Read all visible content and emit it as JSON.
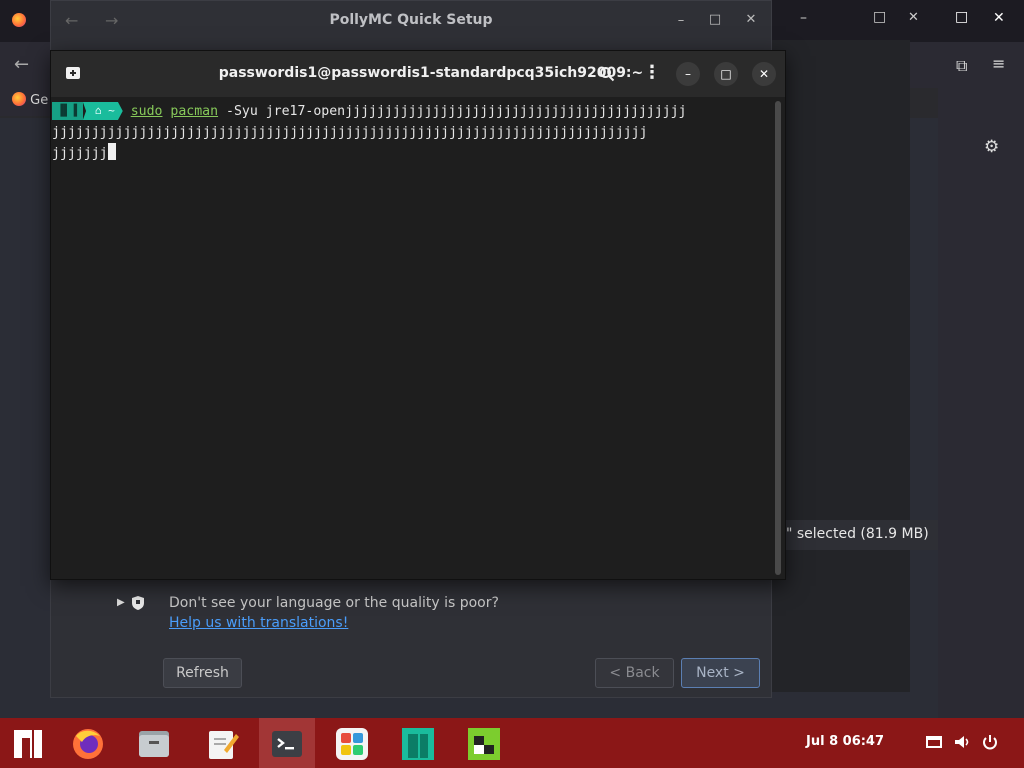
{
  "browser": {
    "bookmark_label": "Ge",
    "right_selected_text": "\" selected  (81.9 MB)"
  },
  "setup_dialog": {
    "title": "PollyMC Quick Setup",
    "language_note": "Don't see your language or the quality is poor?",
    "translations_link": "Help us with translations!",
    "refresh_label": "Refresh",
    "back_label": "< Back",
    "next_label": "Next >"
  },
  "terminal": {
    "title": "passwordis1@passwordis1-standardpcq35ich92009:~",
    "prompt_home": "~",
    "command_sudo": "sudo",
    "command_pacman": "pacman",
    "command_rest_line1": " -Syu jre17-openjjjjjjjjjjjjjjjjjjjjjjjjjjjjjjjjjjjjjjjjjjj",
    "command_line2": "jjjjjjjjjjjjjjjjjjjjjjjjjjjjjjjjjjjjjjjjjjjjjjjjjjjjjjjjjjjjjjjjjjjjjjjjjjj",
    "command_line3": "jjjjjjj"
  },
  "taskbar": {
    "clock": "Jul 8  06:47"
  },
  "icons": {
    "window_minimize": "–",
    "window_maximize": "□",
    "window_close": "✕"
  },
  "colors": {
    "taskbar": "#8b1717",
    "prompt_accent": "#1abc9c",
    "link": "#4a9dfa"
  }
}
